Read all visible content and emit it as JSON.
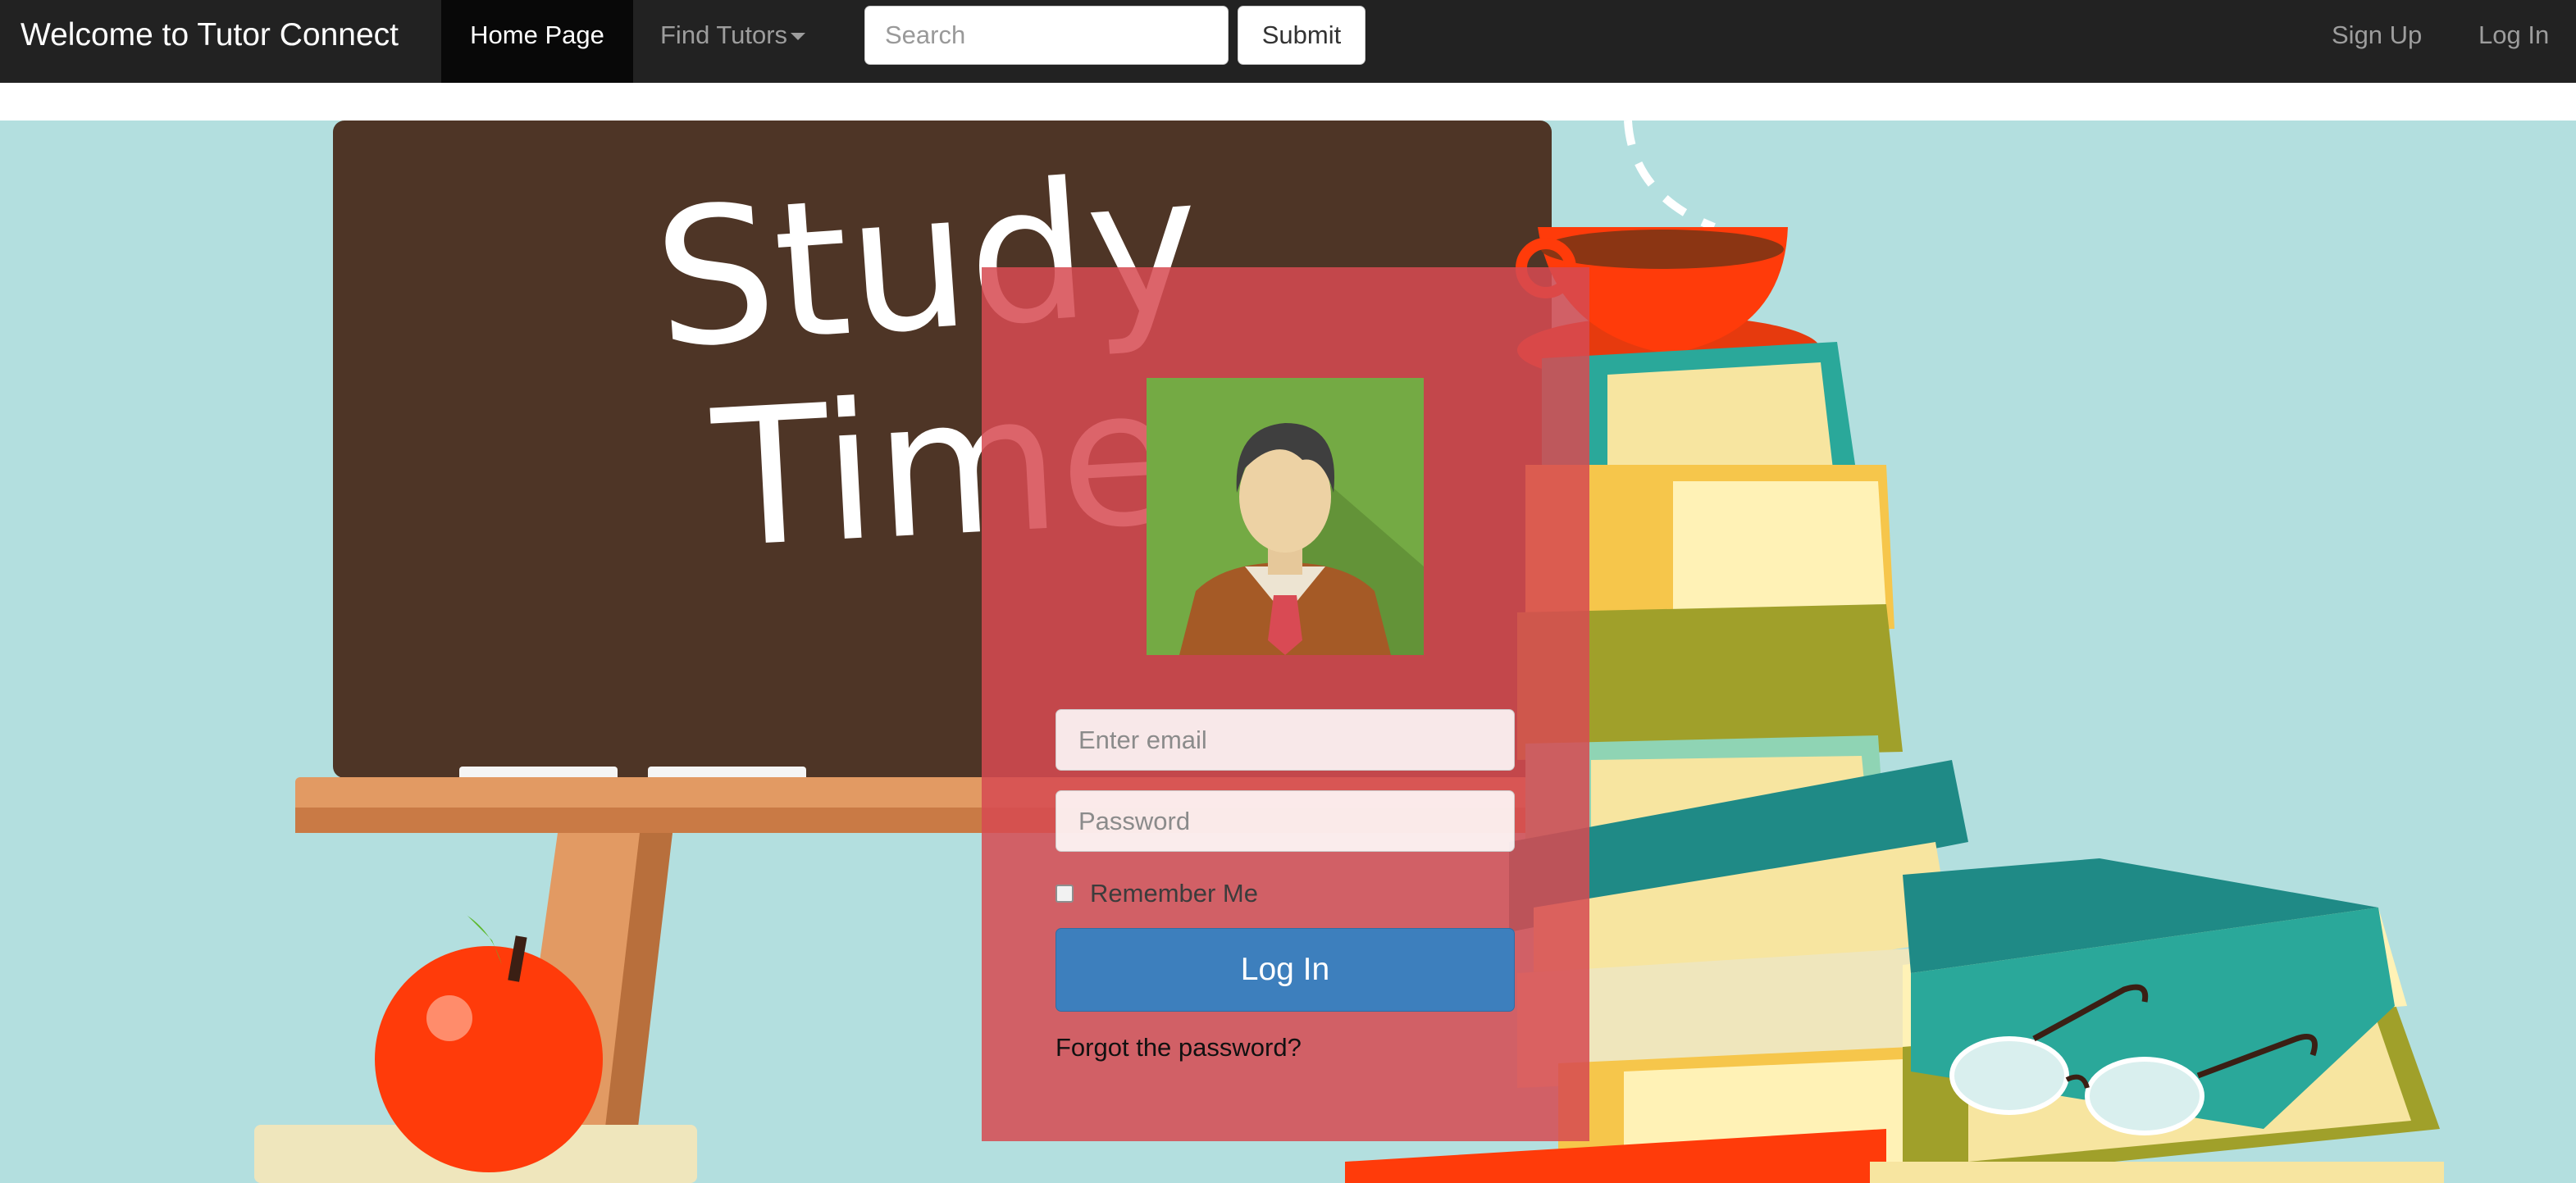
{
  "navbar": {
    "brand": "Welcome to Tutor Connect",
    "home": "Home Page",
    "find_tutors": "Find Tutors",
    "search_placeholder": "Search",
    "submit": "Submit",
    "sign_up": "Sign Up",
    "log_in": "Log In"
  },
  "hero": {
    "board_text_line1": "Study",
    "board_text_line2": "Time!"
  },
  "login": {
    "email_placeholder": "Enter email",
    "password_placeholder": "Password",
    "remember_label": "Remember Me",
    "remember_checked": false,
    "button": "Log In",
    "forgot": "Forgot the password?"
  },
  "colors": {
    "navbar_bg": "#222222",
    "active_tab_bg": "#080808",
    "hero_bg": "#b3dfdf",
    "panel_bg": "#d64a52",
    "login_button": "#3d7fbd"
  }
}
